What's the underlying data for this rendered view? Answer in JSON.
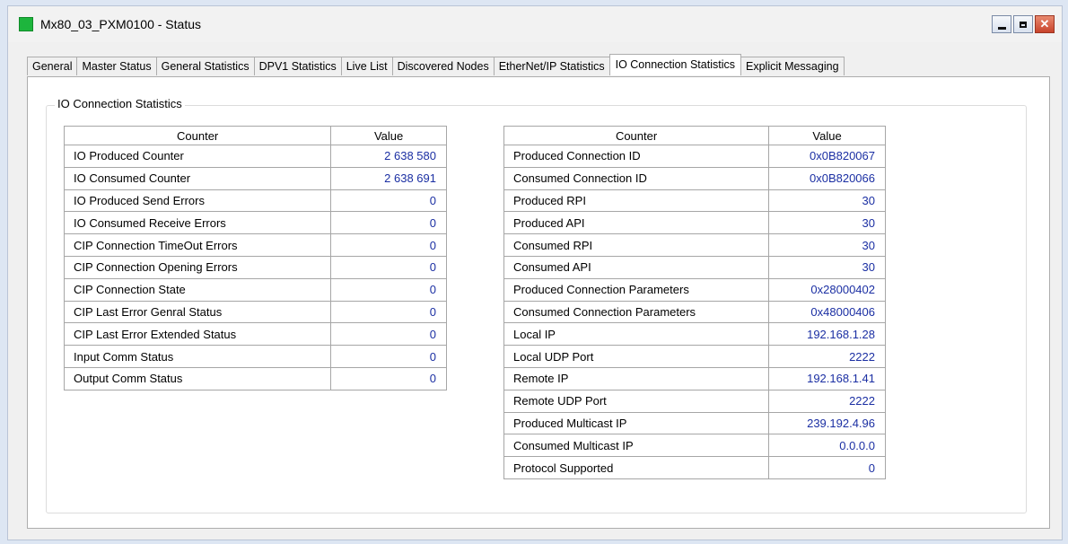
{
  "window": {
    "title": "Mx80_03_PXM0100 - Status",
    "icon": "green-square-icon",
    "colors": {
      "icon": "#1db53d",
      "value_text": "#1b2fa3",
      "close_button": "#c8432b"
    }
  },
  "tabs": [
    {
      "label": "General",
      "active": false
    },
    {
      "label": "Master Status",
      "active": false
    },
    {
      "label": "General Statistics",
      "active": false
    },
    {
      "label": "DPV1 Statistics",
      "active": false
    },
    {
      "label": "Live List",
      "active": false
    },
    {
      "label": "Discovered Nodes",
      "active": false
    },
    {
      "label": "EtherNet/IP Statistics",
      "active": false
    },
    {
      "label": "IO Connection Statistics",
      "active": true
    },
    {
      "label": "Explicit Messaging",
      "active": false
    }
  ],
  "group": {
    "title": "IO Connection Statistics"
  },
  "left_table": {
    "headers": [
      "Counter",
      "Value"
    ],
    "rows": [
      [
        "IO Produced Counter",
        "2 638 580"
      ],
      [
        "IO Consumed Counter",
        "2 638 691"
      ],
      [
        "IO Produced Send Errors",
        "0"
      ],
      [
        "IO Consumed Receive Errors",
        "0"
      ],
      [
        "CIP Connection TimeOut Errors",
        "0"
      ],
      [
        "CIP Connection Opening Errors",
        "0"
      ],
      [
        "CIP Connection State",
        "0"
      ],
      [
        "CIP Last Error Genral Status",
        "0"
      ],
      [
        "CIP Last Error Extended Status",
        "0"
      ],
      [
        "Input Comm Status",
        "0"
      ],
      [
        "Output Comm Status",
        "0"
      ]
    ]
  },
  "right_table": {
    "headers": [
      "Counter",
      "Value"
    ],
    "rows": [
      [
        "Produced Connection ID",
        "0x0B820067"
      ],
      [
        "Consumed Connection ID",
        "0x0B820066"
      ],
      [
        "Produced RPI",
        "30"
      ],
      [
        "Produced API",
        "30"
      ],
      [
        "Consumed RPI",
        "30"
      ],
      [
        "Consumed API",
        "30"
      ],
      [
        "Produced Connection Parameters",
        "0x28000402"
      ],
      [
        "Consumed Connection Parameters",
        "0x48000406"
      ],
      [
        "Local IP",
        "192.168.1.28"
      ],
      [
        "Local UDP Port",
        "2222"
      ],
      [
        "Remote IP",
        "192.168.1.41"
      ],
      [
        "Remote UDP Port",
        "2222"
      ],
      [
        "Produced Multicast IP",
        "239.192.4.96"
      ],
      [
        "Consumed Multicast IP",
        "0.0.0.0"
      ],
      [
        "Protocol Supported",
        "0"
      ]
    ]
  }
}
